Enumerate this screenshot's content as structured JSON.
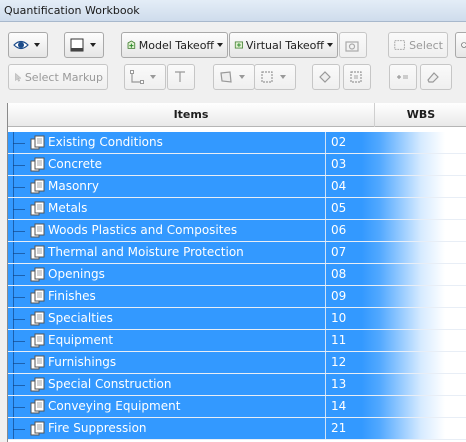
{
  "window": {
    "title": "Quantification Workbook"
  },
  "toolbar1": {
    "model_takeoff_label": "Model Takeoff",
    "virtual_takeoff_label": "Virtual Takeoff",
    "select_label": "Select"
  },
  "toolbar2": {
    "select_markup_label": "Select Markup"
  },
  "grid": {
    "columns": [
      "Items",
      "WBS"
    ],
    "rows": [
      {
        "name": "Existing Conditions",
        "wbs": "02"
      },
      {
        "name": "Concrete",
        "wbs": "03"
      },
      {
        "name": "Masonry",
        "wbs": "04"
      },
      {
        "name": "Metals",
        "wbs": "05"
      },
      {
        "name": "Woods Plastics and Composites",
        "wbs": "06"
      },
      {
        "name": "Thermal and Moisture Protection",
        "wbs": "07"
      },
      {
        "name": "Openings",
        "wbs": "08"
      },
      {
        "name": "Finishes",
        "wbs": "09"
      },
      {
        "name": "Specialties",
        "wbs": "10"
      },
      {
        "name": "Equipment",
        "wbs": "11"
      },
      {
        "name": "Furnishings",
        "wbs": "12"
      },
      {
        "name": "Special Construction",
        "wbs": "13"
      },
      {
        "name": "Conveying Equipment",
        "wbs": "14"
      },
      {
        "name": "Fire Suppression",
        "wbs": "21"
      }
    ]
  },
  "colors": {
    "selection": "#3399ff",
    "title_bar": "#d6e2f0"
  }
}
